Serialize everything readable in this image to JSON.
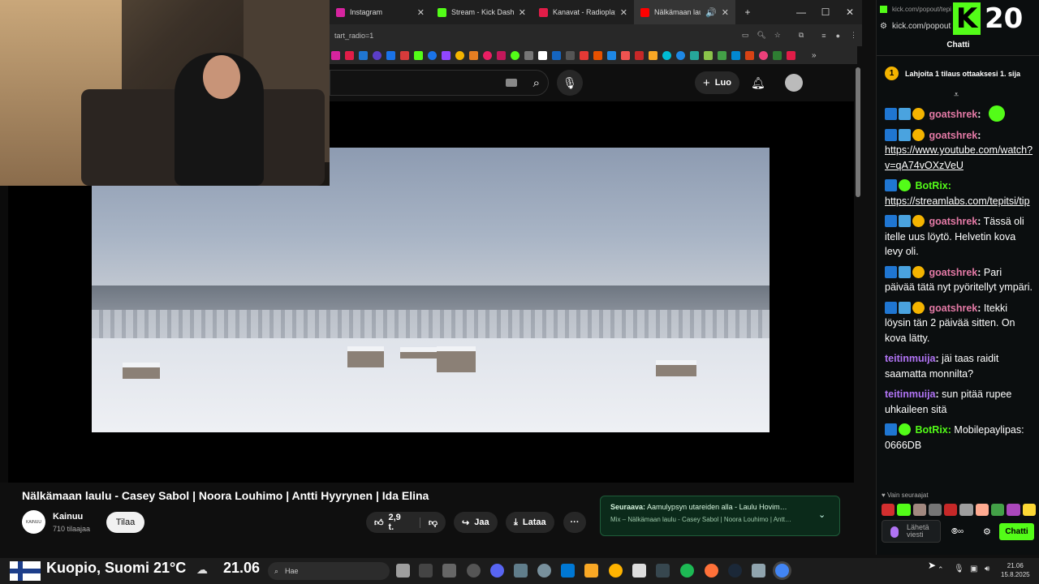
{
  "browser": {
    "tabs": [
      {
        "label": "Instagram",
        "color": "#d6249f"
      },
      {
        "label": "Stream - Kick Dashbo",
        "color": "#53fc18"
      },
      {
        "label": "Kanavat - Radioplayer",
        "color": "#e11d48"
      },
      {
        "label": "Nälkämaan laulu",
        "color": "#ff0000"
      }
    ],
    "url_fragment": "tart_radio=1"
  },
  "youtube": {
    "create_label": "Luo",
    "video_title": "Nälkämaan laulu - Casey Sabol | Noora Louhimo | Antti Hyyrynen | Ida Elina",
    "channel_name": "Kainuu",
    "channel_avatar_text": "KAINUU",
    "channel_subs": "710 tilaajaa",
    "subscribe_label": "Tilaa",
    "likes": "2,9 t.",
    "share_label": "Jaa",
    "download_label": "Lataa",
    "more_label": "···",
    "up_next_prefix": "Seuraava:",
    "up_next_title": "Aamulypsyn utareiden alla - Laulu Hovim…",
    "up_next_mix": "Mix – Nälkämaan laulu - Casey Sabol | Noora Louhimo | Antt…"
  },
  "chat": {
    "popout_url": "kick.com/popout/tepi",
    "address": "kick.com/popout",
    "viewer_count": "20",
    "title": "Chatti",
    "gift_rank": "1",
    "gift_text": "Lahjoita 1 tilaus ottaaksesi 1. sija",
    "messages": [
      {
        "user": "goatshrek",
        "text": "",
        "emote": true
      },
      {
        "user": "goatshrek",
        "text": "https://www.youtube.com/watch?v=qA74vOXzVeU",
        "link": true
      },
      {
        "user": "BotRix",
        "text": "https://streamlabs.com/tepitsi/tip",
        "link": true
      },
      {
        "user": "goatshrek",
        "text": "Tässä oli itelle uus löytö. Helvetin kova levy oli."
      },
      {
        "user": "goatshrek",
        "text": "Pari päivää tätä nyt pyöritellyt ympäri."
      },
      {
        "user": "goatshrek",
        "text": "Itekki löysin tän 2 päivää sitten. On kova lätty."
      },
      {
        "user": "teitinmuija",
        "text": "jäi taas raidit saamatta monnilta?"
      },
      {
        "user": "teitinmuija",
        "text": "sun pitää rupee uhkaileen sitä"
      },
      {
        "user": "BotRix",
        "text": "Mobilepaylipas: 0666DB"
      }
    ],
    "follower_only": "Vain seuraajat",
    "input_placeholder": "Lähetä viesti",
    "send_label": "Chatti",
    "accent": "#53fc18"
  },
  "taskbar": {
    "weather": "Kuopio, Suomi 21°C",
    "temp_right": "21.06",
    "search_placeholder": "Hae",
    "time": "21.06",
    "date": "15.8.2025"
  }
}
